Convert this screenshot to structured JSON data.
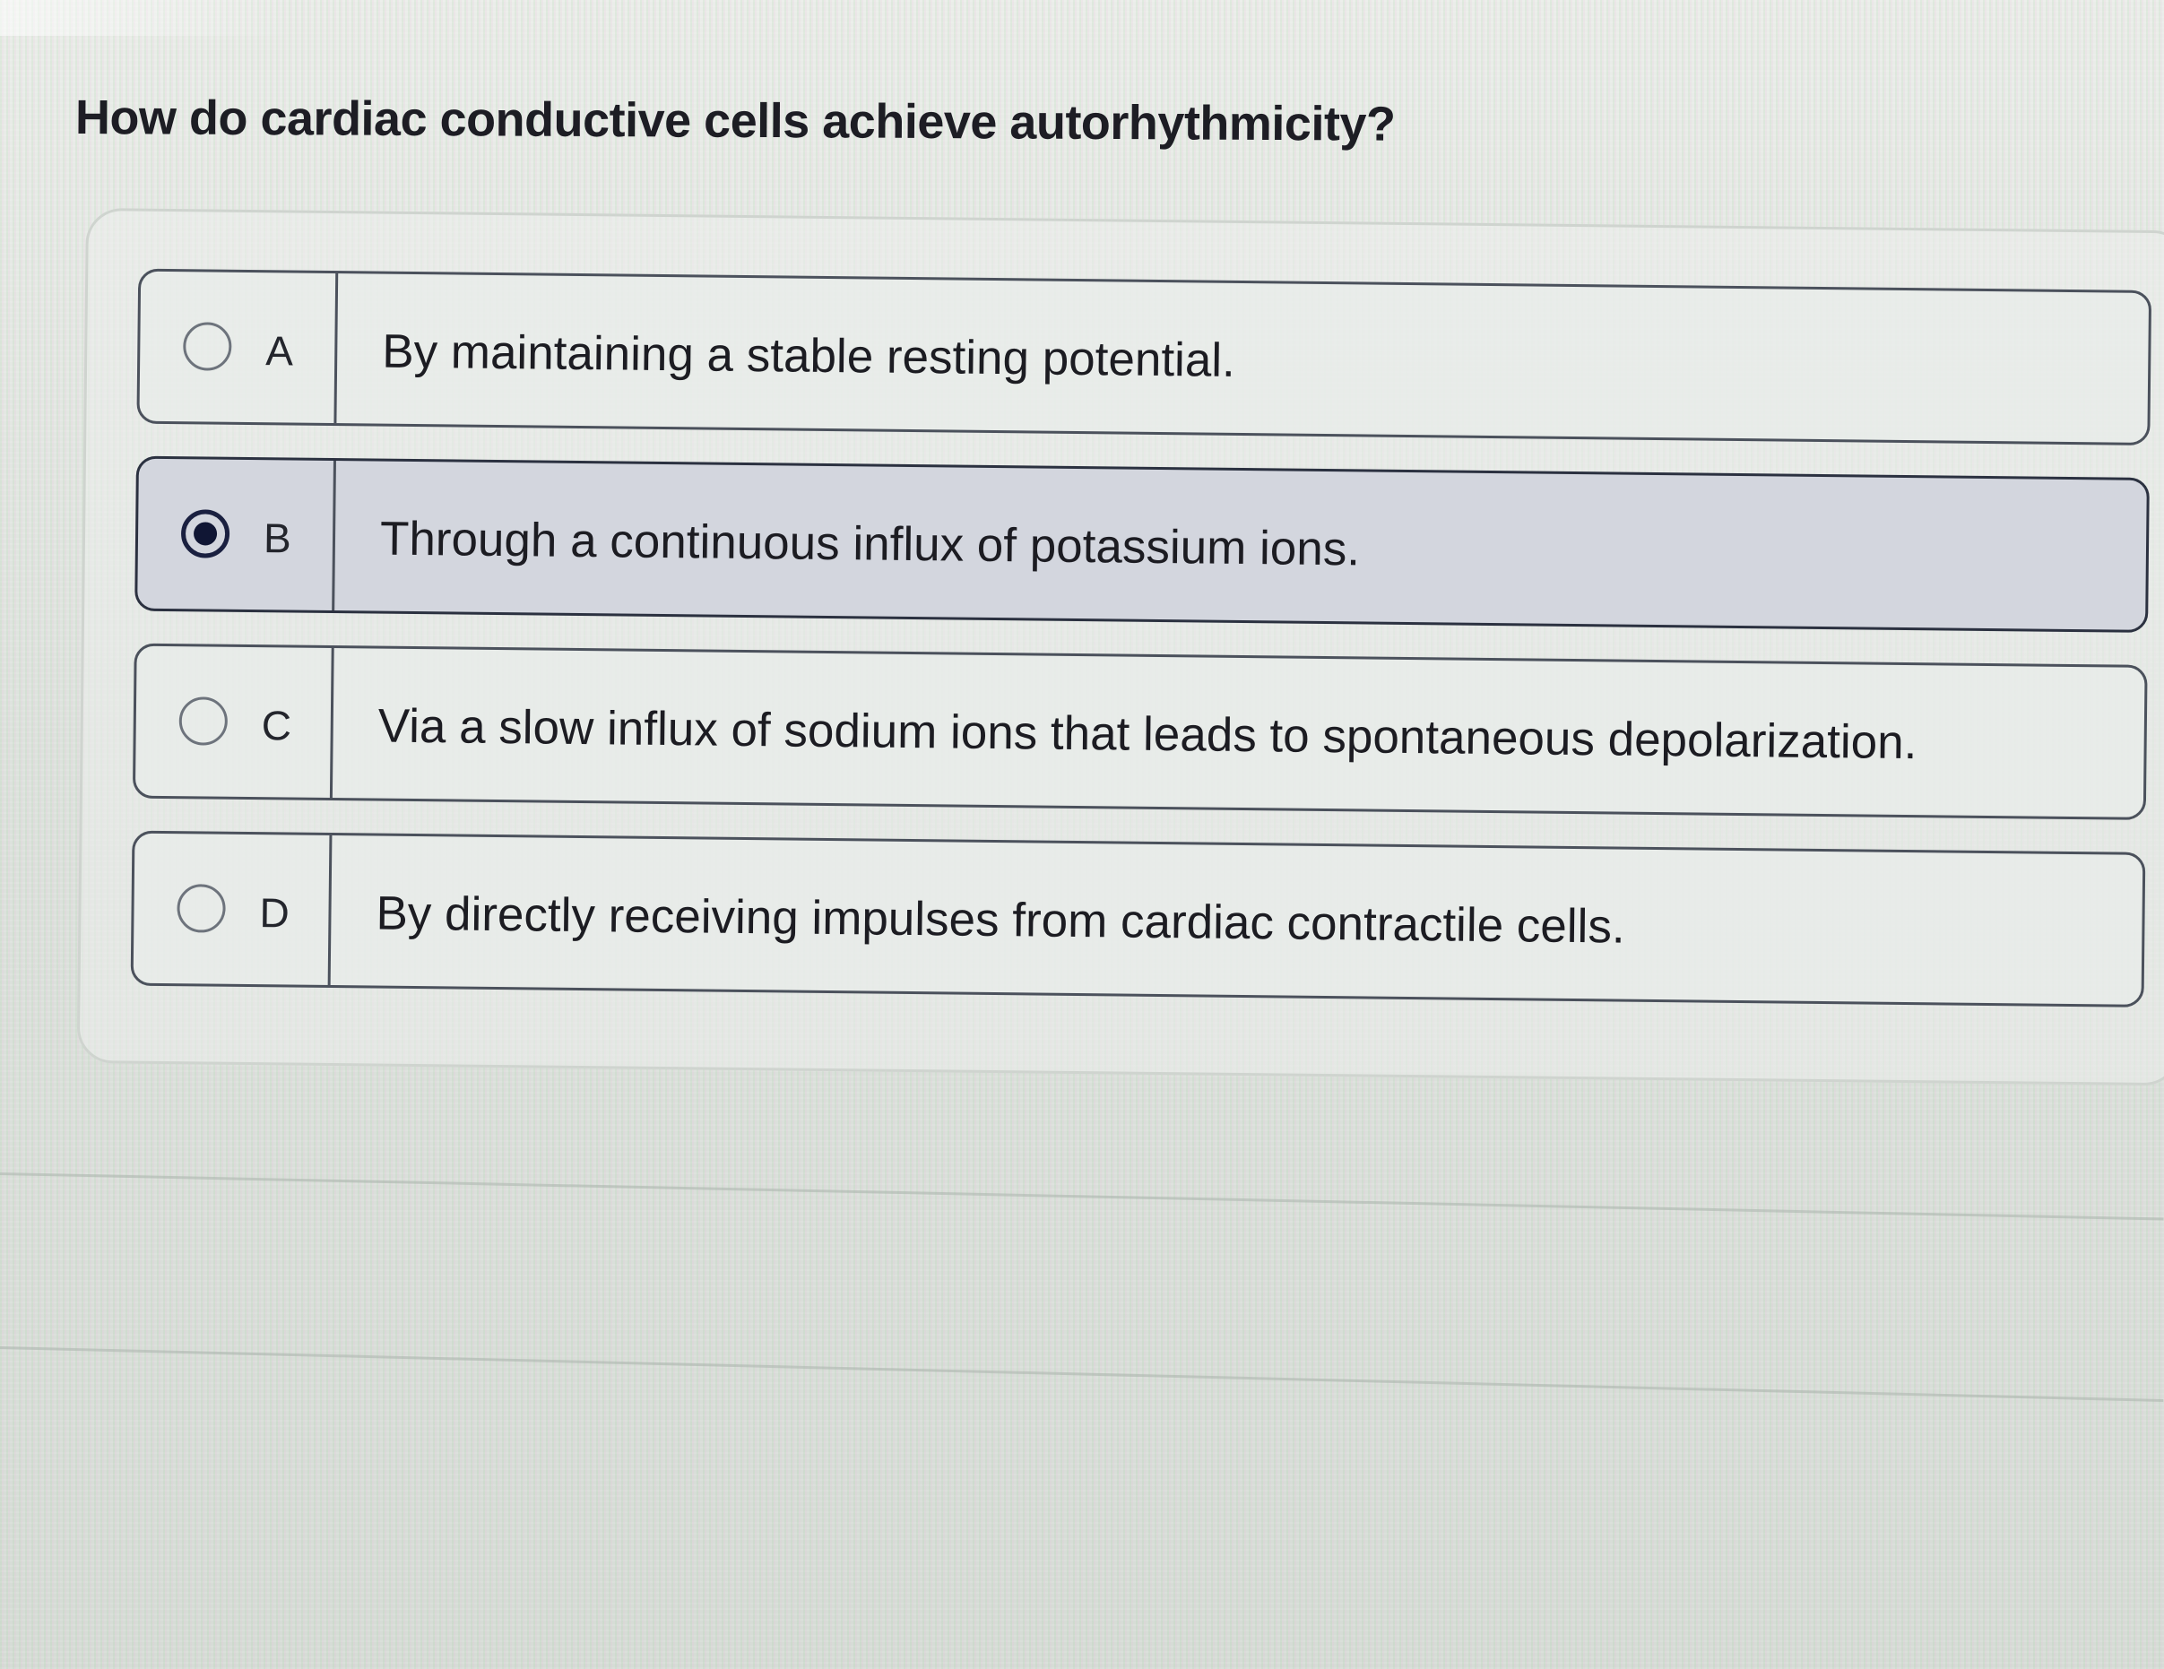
{
  "question": {
    "text": "How do cardiac conductive cells achieve autorhythmicity?"
  },
  "options": [
    {
      "letter": "A",
      "text": "By maintaining a stable resting potential.",
      "selected": false
    },
    {
      "letter": "B",
      "text": "Through a continuous influx of potassium ions.",
      "selected": true
    },
    {
      "letter": "C",
      "text": "Via a slow influx of sodium ions that leads to spontaneous depolarization.",
      "selected": false
    },
    {
      "letter": "D",
      "text": "By directly receiving impulses from cardiac contractile cells.",
      "selected": false
    }
  ],
  "colors": {
    "selected_radio": "#101634",
    "option_border": "#4b515c",
    "selected_background": "#d3d6de"
  }
}
